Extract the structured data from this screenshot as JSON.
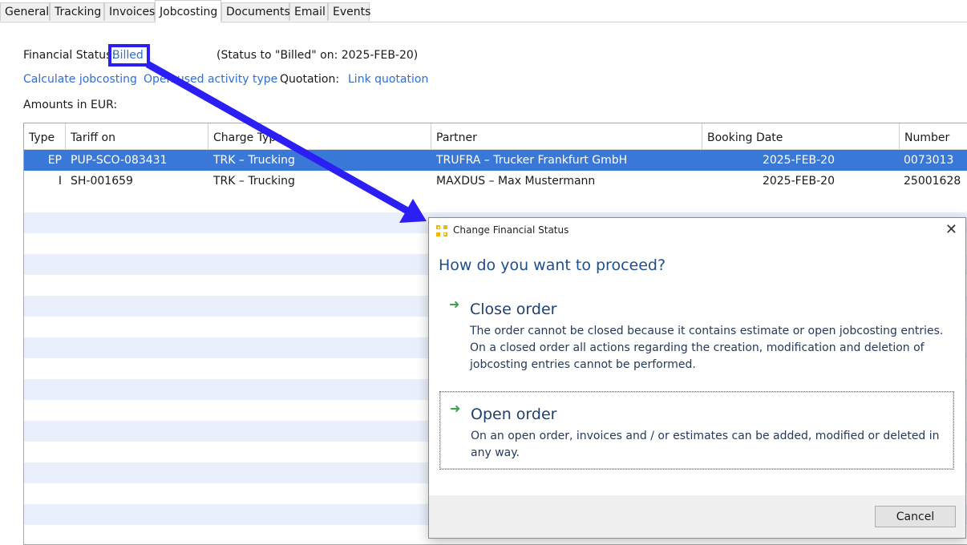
{
  "tabs": [
    {
      "label": "General",
      "active": false
    },
    {
      "label": "Tracking",
      "active": false
    },
    {
      "label": "Invoices",
      "active": false
    },
    {
      "label": "Jobcosting",
      "active": true
    },
    {
      "label": "Documents",
      "active": false
    },
    {
      "label": "Email",
      "active": false
    },
    {
      "label": "Events",
      "active": false
    }
  ],
  "header": {
    "financial_status_label": "Financial Status:",
    "financial_status_value": "Billed",
    "status_note": "(Status to \"Billed\" on: 2025-FEB-20)",
    "calc_link": "Calculate jobcosting",
    "open_activity_link": "Open used activity type",
    "quotation_label": "Quotation:",
    "link_quotation": "Link quotation",
    "amounts_label": "Amounts in EUR:"
  },
  "grid": {
    "columns": [
      "Type",
      "Tariff on",
      "Charge Type",
      "Partner",
      "Booking Date",
      "Number"
    ],
    "rows": [
      {
        "type": "EP",
        "tariff": "PUP-SCO-083431",
        "charge": "TRK – Trucking",
        "partner": "TRUFRA – Trucker Frankfurt GmbH",
        "date": "2025-FEB-20",
        "number": "0073013",
        "selected": true
      },
      {
        "type": "I",
        "tariff": "SH-001659",
        "charge": "TRK – Trucking",
        "partner": "MAXDUS – Max Mustermann",
        "date": "2025-FEB-20",
        "number": "25001628",
        "selected": false
      }
    ]
  },
  "dialog": {
    "title": "Change Financial Status",
    "question": "How do you want to proceed?",
    "options": [
      {
        "title": "Close order",
        "desc": "The order cannot be closed because it contains estimate or open jobcosting entries. On a closed order all actions regarding the creation, modification and deletion of jobcosting entries cannot be performed."
      },
      {
        "title": "Open order",
        "desc": "On an open order, invoices and / or estimates can be added, modified or deleted in any way."
      }
    ],
    "cancel_label": "Cancel",
    "close_glyph": "✕"
  },
  "colors": {
    "link": "#2f6fd1",
    "selection": "#3a78d8",
    "annotation": "#2b1ff5",
    "dialog_heading": "#1f4e8c",
    "option_arrow": "#3da34a"
  }
}
